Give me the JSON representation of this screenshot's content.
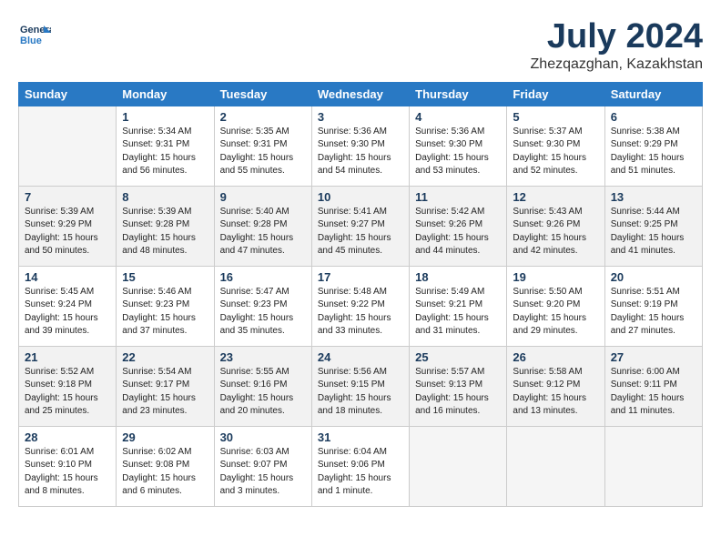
{
  "header": {
    "logo_line1": "General",
    "logo_line2": "Blue",
    "month_year": "July 2024",
    "location": "Zhezqazghan, Kazakhstan"
  },
  "weekdays": [
    "Sunday",
    "Monday",
    "Tuesday",
    "Wednesday",
    "Thursday",
    "Friday",
    "Saturday"
  ],
  "weeks": [
    [
      {
        "day": "",
        "text": ""
      },
      {
        "day": "1",
        "text": "Sunrise: 5:34 AM\nSunset: 9:31 PM\nDaylight: 15 hours\nand 56 minutes."
      },
      {
        "day": "2",
        "text": "Sunrise: 5:35 AM\nSunset: 9:31 PM\nDaylight: 15 hours\nand 55 minutes."
      },
      {
        "day": "3",
        "text": "Sunrise: 5:36 AM\nSunset: 9:30 PM\nDaylight: 15 hours\nand 54 minutes."
      },
      {
        "day": "4",
        "text": "Sunrise: 5:36 AM\nSunset: 9:30 PM\nDaylight: 15 hours\nand 53 minutes."
      },
      {
        "day": "5",
        "text": "Sunrise: 5:37 AM\nSunset: 9:30 PM\nDaylight: 15 hours\nand 52 minutes."
      },
      {
        "day": "6",
        "text": "Sunrise: 5:38 AM\nSunset: 9:29 PM\nDaylight: 15 hours\nand 51 minutes."
      }
    ],
    [
      {
        "day": "7",
        "text": "Sunrise: 5:39 AM\nSunset: 9:29 PM\nDaylight: 15 hours\nand 50 minutes."
      },
      {
        "day": "8",
        "text": "Sunrise: 5:39 AM\nSunset: 9:28 PM\nDaylight: 15 hours\nand 48 minutes."
      },
      {
        "day": "9",
        "text": "Sunrise: 5:40 AM\nSunset: 9:28 PM\nDaylight: 15 hours\nand 47 minutes."
      },
      {
        "day": "10",
        "text": "Sunrise: 5:41 AM\nSunset: 9:27 PM\nDaylight: 15 hours\nand 45 minutes."
      },
      {
        "day": "11",
        "text": "Sunrise: 5:42 AM\nSunset: 9:26 PM\nDaylight: 15 hours\nand 44 minutes."
      },
      {
        "day": "12",
        "text": "Sunrise: 5:43 AM\nSunset: 9:26 PM\nDaylight: 15 hours\nand 42 minutes."
      },
      {
        "day": "13",
        "text": "Sunrise: 5:44 AM\nSunset: 9:25 PM\nDaylight: 15 hours\nand 41 minutes."
      }
    ],
    [
      {
        "day": "14",
        "text": "Sunrise: 5:45 AM\nSunset: 9:24 PM\nDaylight: 15 hours\nand 39 minutes."
      },
      {
        "day": "15",
        "text": "Sunrise: 5:46 AM\nSunset: 9:23 PM\nDaylight: 15 hours\nand 37 minutes."
      },
      {
        "day": "16",
        "text": "Sunrise: 5:47 AM\nSunset: 9:23 PM\nDaylight: 15 hours\nand 35 minutes."
      },
      {
        "day": "17",
        "text": "Sunrise: 5:48 AM\nSunset: 9:22 PM\nDaylight: 15 hours\nand 33 minutes."
      },
      {
        "day": "18",
        "text": "Sunrise: 5:49 AM\nSunset: 9:21 PM\nDaylight: 15 hours\nand 31 minutes."
      },
      {
        "day": "19",
        "text": "Sunrise: 5:50 AM\nSunset: 9:20 PM\nDaylight: 15 hours\nand 29 minutes."
      },
      {
        "day": "20",
        "text": "Sunrise: 5:51 AM\nSunset: 9:19 PM\nDaylight: 15 hours\nand 27 minutes."
      }
    ],
    [
      {
        "day": "21",
        "text": "Sunrise: 5:52 AM\nSunset: 9:18 PM\nDaylight: 15 hours\nand 25 minutes."
      },
      {
        "day": "22",
        "text": "Sunrise: 5:54 AM\nSunset: 9:17 PM\nDaylight: 15 hours\nand 23 minutes."
      },
      {
        "day": "23",
        "text": "Sunrise: 5:55 AM\nSunset: 9:16 PM\nDaylight: 15 hours\nand 20 minutes."
      },
      {
        "day": "24",
        "text": "Sunrise: 5:56 AM\nSunset: 9:15 PM\nDaylight: 15 hours\nand 18 minutes."
      },
      {
        "day": "25",
        "text": "Sunrise: 5:57 AM\nSunset: 9:13 PM\nDaylight: 15 hours\nand 16 minutes."
      },
      {
        "day": "26",
        "text": "Sunrise: 5:58 AM\nSunset: 9:12 PM\nDaylight: 15 hours\nand 13 minutes."
      },
      {
        "day": "27",
        "text": "Sunrise: 6:00 AM\nSunset: 9:11 PM\nDaylight: 15 hours\nand 11 minutes."
      }
    ],
    [
      {
        "day": "28",
        "text": "Sunrise: 6:01 AM\nSunset: 9:10 PM\nDaylight: 15 hours\nand 8 minutes."
      },
      {
        "day": "29",
        "text": "Sunrise: 6:02 AM\nSunset: 9:08 PM\nDaylight: 15 hours\nand 6 minutes."
      },
      {
        "day": "30",
        "text": "Sunrise: 6:03 AM\nSunset: 9:07 PM\nDaylight: 15 hours\nand 3 minutes."
      },
      {
        "day": "31",
        "text": "Sunrise: 6:04 AM\nSunset: 9:06 PM\nDaylight: 15 hours\nand 1 minute."
      },
      {
        "day": "",
        "text": ""
      },
      {
        "day": "",
        "text": ""
      },
      {
        "day": "",
        "text": ""
      }
    ]
  ]
}
